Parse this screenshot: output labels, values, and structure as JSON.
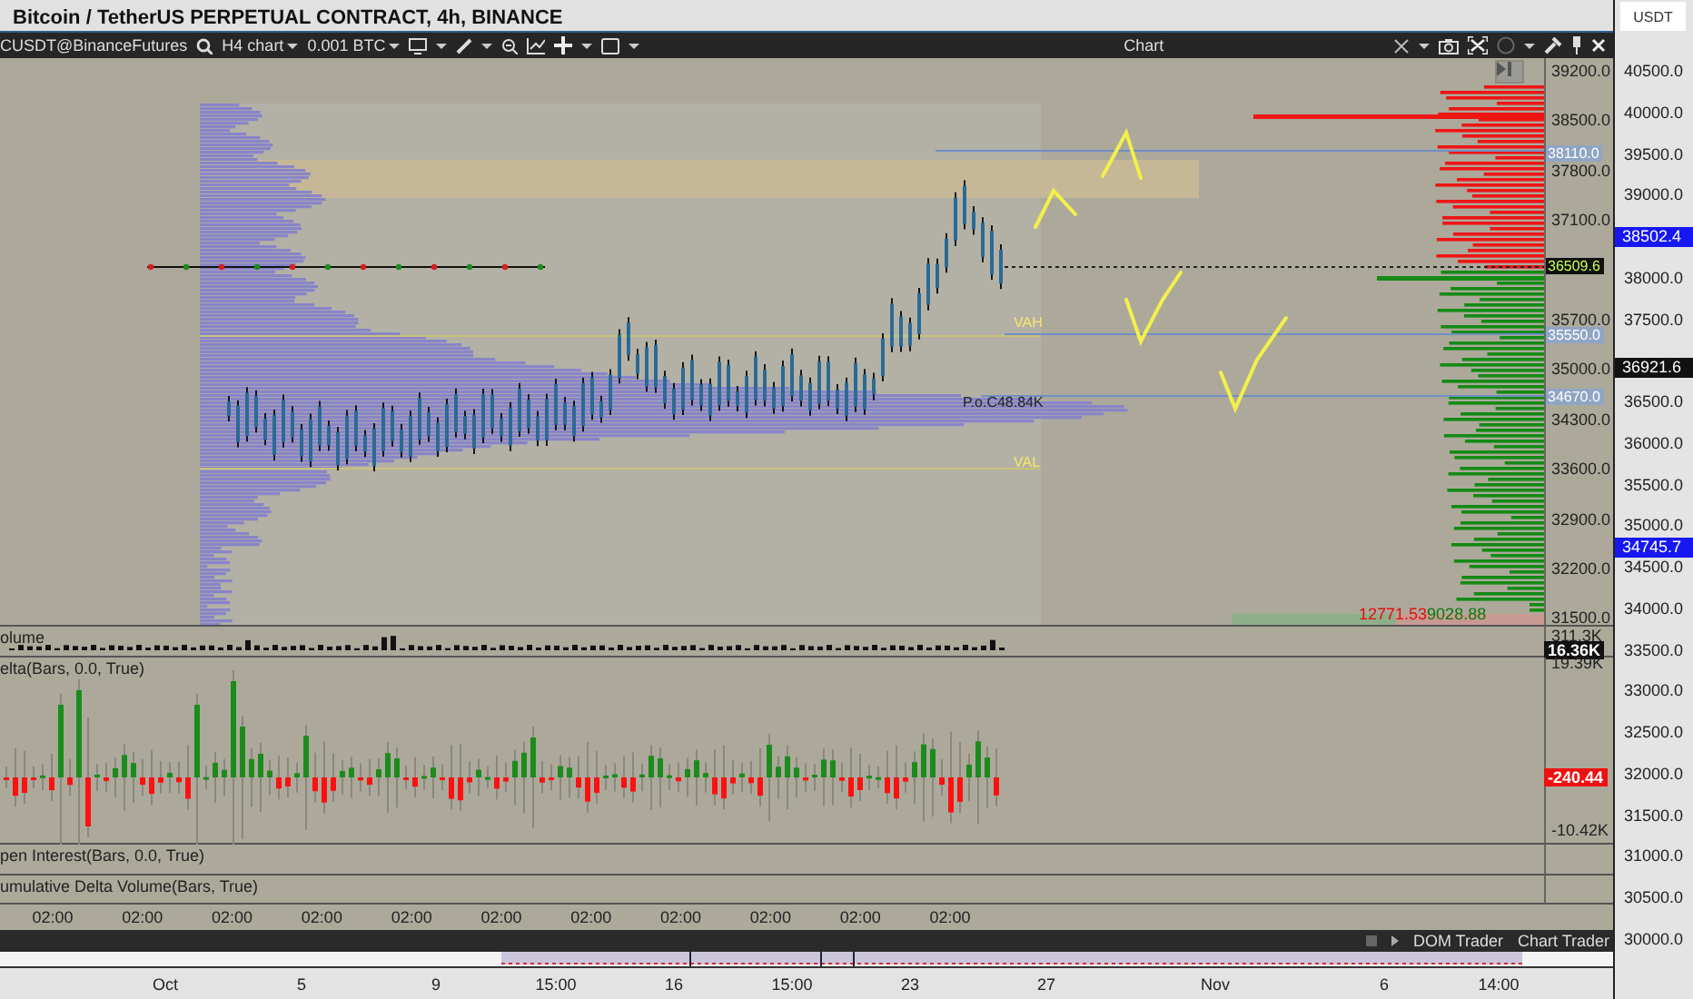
{
  "window": {
    "title": "Bitcoin / TetherUS PERPETUAL CONTRACT, 4h, BINANCE"
  },
  "toolbar": {
    "instrument": "CUSDT@BinanceFutures",
    "interval": "H4 chart",
    "quantity": "0.001 BTC",
    "title": "Chart"
  },
  "currency": "USDT",
  "outer_axis": {
    "labels": [
      "40500.0",
      "40000.0",
      "39500.0",
      "39000.0",
      "38000.0",
      "37500.0",
      "36500.0",
      "36000.0",
      "35500.0",
      "35000.0",
      "34500.0",
      "34000.0",
      "33500.0",
      "33000.0",
      "32500.0",
      "32000.0",
      "31500.0",
      "31000.0",
      "30500.0",
      "30000.0"
    ],
    "tags": [
      {
        "text": "38502.4",
        "kind": "marker"
      },
      {
        "text": "36921.6",
        "kind": "last"
      },
      {
        "text": "34745.7",
        "kind": "marker"
      }
    ]
  },
  "price_chart": {
    "axis_labels": [
      "39200.0",
      "38500.0",
      "37800.0",
      "37100.0",
      "35700.0",
      "35000.0",
      "34300.0",
      "33600.0",
      "32900.0",
      "32200.0",
      "31500.0"
    ],
    "level_tags": [
      {
        "text": "38110.0",
        "kind": "level"
      },
      {
        "text": "36509.6",
        "kind": "current"
      },
      {
        "text": "35550.0",
        "kind": "level"
      },
      {
        "text": "34670.0",
        "kind": "level"
      }
    ],
    "profile_labels": [
      {
        "text": "VAH",
        "kind": "high"
      },
      {
        "text": "P.o.C48.84K",
        "kind": "poc"
      },
      {
        "text": "VAL",
        "kind": "low"
      }
    ],
    "ask_total": "12771.53",
    "bid_total": "9028.88"
  },
  "panels": [
    {
      "kind": "volume",
      "label": "olume",
      "axis_top": "311.3K",
      "tag": "16.36K"
    },
    {
      "kind": "delta",
      "label": "elta(Bars, 0.0, True)",
      "axis_top": "19.39K",
      "tag": "-240.44",
      "axis_bottom": "-10.42K"
    },
    {
      "kind": "open_interest",
      "label": "pen Interest(Bars, 0.0, True)"
    },
    {
      "kind": "cdv",
      "label": "umulative Delta Volume(Bars, True)"
    }
  ],
  "time_axis": [
    "02:00",
    "02:00",
    "02:00",
    "02:00",
    "02:00",
    "02:00",
    "02:00",
    "02:00",
    "02:00",
    "02:00",
    "02:00"
  ],
  "trader_tabs": [
    "DOM Trader",
    "Chart Trader"
  ],
  "date_axis": [
    "Oct",
    "5",
    "9",
    "15:00",
    "16",
    "15:00",
    "23",
    "27",
    "Nov",
    "6",
    "14:00"
  ]
}
